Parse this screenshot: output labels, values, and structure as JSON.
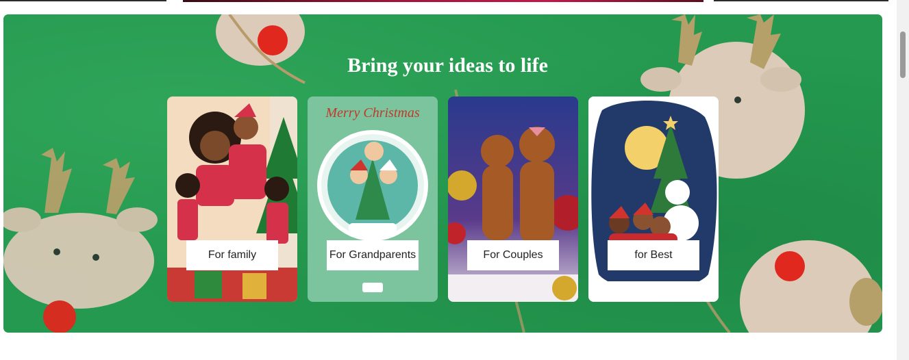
{
  "hero": {
    "title": "Bring your ideas to life",
    "background_color": "#24994f"
  },
  "cards": [
    {
      "label": "For family",
      "image": "family-christmas-illustration"
    },
    {
      "label": "For Grandparents",
      "image": "merry-christmas-vintage-illustration",
      "image_text": "Merry Christmas"
    },
    {
      "label": "For Couples",
      "image": "gingerbread-couple-photo"
    },
    {
      "label": "for Best",
      "image": "friends-snowman-night-illustration"
    }
  ]
}
